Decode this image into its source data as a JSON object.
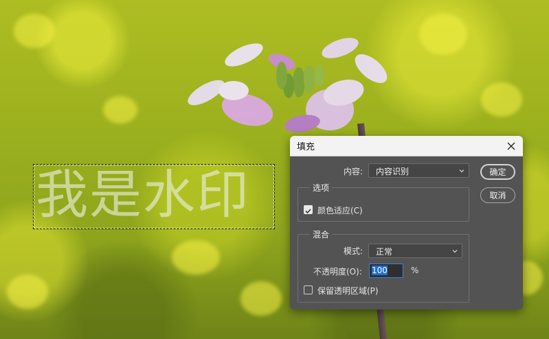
{
  "canvas": {
    "watermark_text": "我是水印"
  },
  "dialog": {
    "title": "填充",
    "close_icon": "close-icon",
    "contents_label": "内容:",
    "contents_value": "内容识别",
    "options_group": "选项",
    "color_adaptation_label": "颜色适应(C)",
    "color_adaptation_checked": true,
    "blending_group": "混合",
    "mode_label": "模式:",
    "mode_value": "正常",
    "opacity_label": "不透明度(O):",
    "opacity_value": "100",
    "opacity_unit": "%",
    "preserve_transparency_label": "保留透明区域(P)",
    "preserve_transparency_checked": false,
    "ok_label": "确定",
    "cancel_label": "取消"
  }
}
